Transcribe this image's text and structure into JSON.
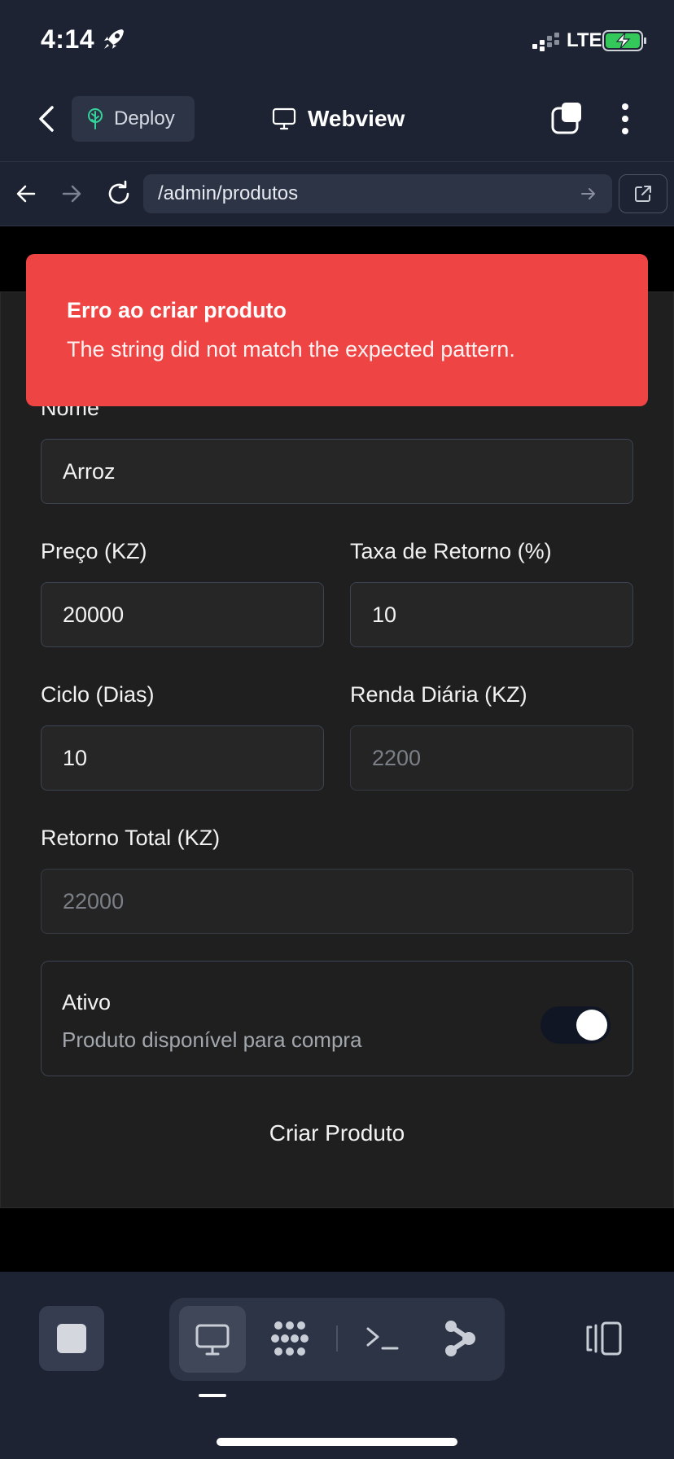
{
  "status_bar": {
    "time": "4:14",
    "network": "LTE",
    "icons": [
      "rocket-icon",
      "signal-icon",
      "battery-charging-icon"
    ]
  },
  "app_header": {
    "deploy_label": "Deploy",
    "title": "Webview",
    "icons": [
      "chevron-left-icon",
      "tree-icon",
      "monitor-icon",
      "tabs-icon",
      "more-vertical-icon"
    ]
  },
  "browser": {
    "url": "/admin/produtos",
    "icons": [
      "arrow-left-icon",
      "arrow-right-icon",
      "reload-icon",
      "go-arrow-icon",
      "external-link-icon"
    ]
  },
  "toast": {
    "title": "Erro ao criar produto",
    "message": "The string did not match the expected pattern.",
    "color": "#ef4444"
  },
  "form": {
    "nome": {
      "label": "Nome",
      "value": "Arroz"
    },
    "preco": {
      "label": "Preço (KZ)",
      "value": "20000"
    },
    "taxa": {
      "label": "Taxa de Retorno (%)",
      "value": "10"
    },
    "ciclo": {
      "label": "Ciclo (Dias)",
      "value": "10"
    },
    "renda": {
      "label": "Renda Diária (KZ)",
      "value": "2200"
    },
    "retorno": {
      "label": "Retorno Total (KZ)",
      "value": "22000"
    },
    "ativo": {
      "title": "Ativo",
      "description": "Produto disponível para compra",
      "checked": true
    },
    "submit_label": "Criar Produto"
  },
  "bottom_bar": {
    "icons": [
      "stop-icon",
      "monitor-icon",
      "dots-grid-icon",
      "terminal-icon",
      "branch-icon",
      "panel-toggle-icon"
    ],
    "active_tab": "monitor"
  }
}
